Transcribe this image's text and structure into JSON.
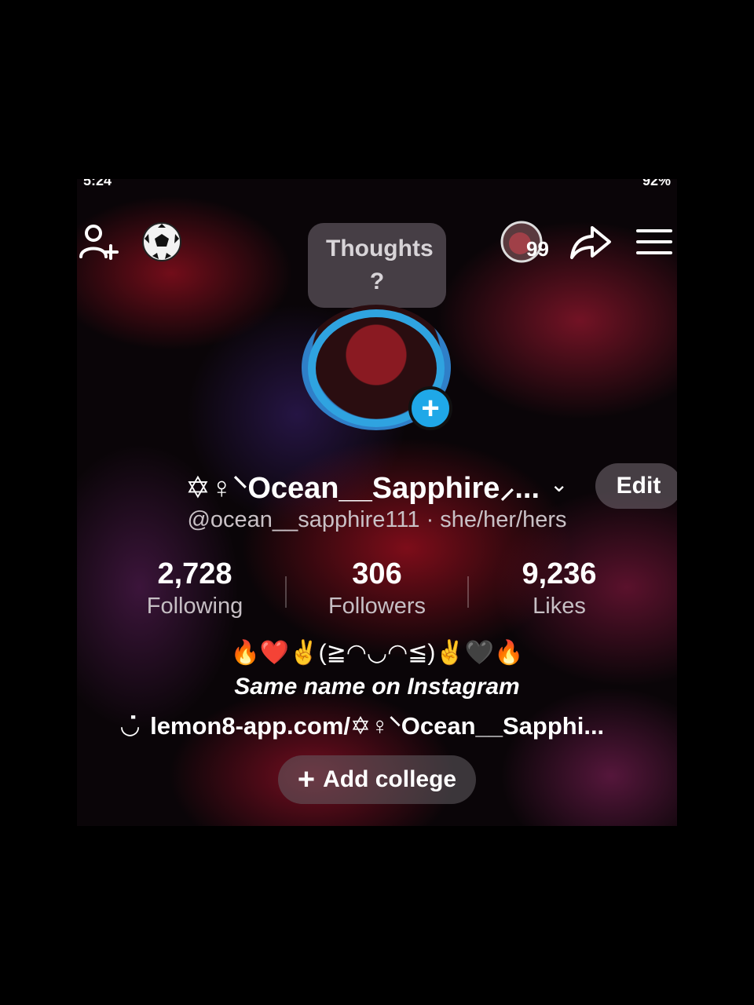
{
  "status_bar": {
    "left": "5:24",
    "right": "92%"
  },
  "top_bar": {
    "add_friend_icon": "person-add-icon",
    "soccer_icon": "soccer-ball-icon",
    "thought_bubble": "Thoughts ?",
    "notification_count": "99",
    "share_icon": "share-arrow-icon",
    "menu_icon": "hamburger-menu-icon"
  },
  "profile": {
    "display_name": "✡♀⸌Ocean__Sapphire⸝...",
    "handle": "@ocean__sapphire111 · she/her/hers",
    "edit_label": "Edit"
  },
  "stats": [
    {
      "value": "2,728",
      "label": "Following"
    },
    {
      "value": "306",
      "label": "Followers"
    },
    {
      "value": "9,236",
      "label": "Likes"
    }
  ],
  "bio": {
    "emoji_line": "🔥❤️✌️(≧◠◡◠≦)✌️🖤🔥",
    "text": "Same name on Instagram",
    "link": "lemon8-app.com/✡♀⸌Ocean__Sapphi..."
  },
  "college_button": "Add college",
  "colors": {
    "accent": "#1fa8e8",
    "pill_bg": "#6e646c"
  }
}
